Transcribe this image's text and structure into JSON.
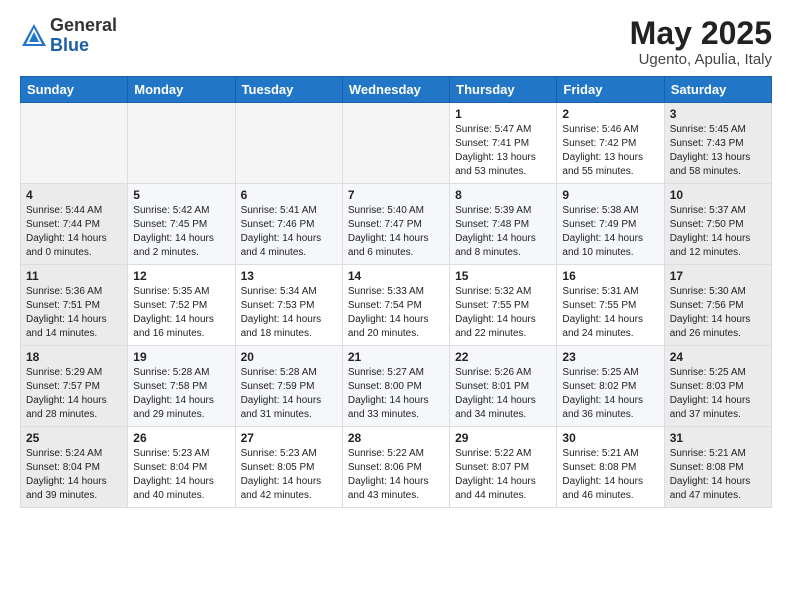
{
  "header": {
    "logo_general": "General",
    "logo_blue": "Blue",
    "month_year": "May 2025",
    "location": "Ugento, Apulia, Italy"
  },
  "days_of_week": [
    "Sunday",
    "Monday",
    "Tuesday",
    "Wednesday",
    "Thursday",
    "Friday",
    "Saturday"
  ],
  "weeks": [
    [
      {
        "day": "",
        "info": ""
      },
      {
        "day": "",
        "info": ""
      },
      {
        "day": "",
        "info": ""
      },
      {
        "day": "",
        "info": ""
      },
      {
        "day": "1",
        "info": "Sunrise: 5:47 AM\nSunset: 7:41 PM\nDaylight: 13 hours\nand 53 minutes."
      },
      {
        "day": "2",
        "info": "Sunrise: 5:46 AM\nSunset: 7:42 PM\nDaylight: 13 hours\nand 55 minutes."
      },
      {
        "day": "3",
        "info": "Sunrise: 5:45 AM\nSunset: 7:43 PM\nDaylight: 13 hours\nand 58 minutes."
      }
    ],
    [
      {
        "day": "4",
        "info": "Sunrise: 5:44 AM\nSunset: 7:44 PM\nDaylight: 14 hours\nand 0 minutes."
      },
      {
        "day": "5",
        "info": "Sunrise: 5:42 AM\nSunset: 7:45 PM\nDaylight: 14 hours\nand 2 minutes."
      },
      {
        "day": "6",
        "info": "Sunrise: 5:41 AM\nSunset: 7:46 PM\nDaylight: 14 hours\nand 4 minutes."
      },
      {
        "day": "7",
        "info": "Sunrise: 5:40 AM\nSunset: 7:47 PM\nDaylight: 14 hours\nand 6 minutes."
      },
      {
        "day": "8",
        "info": "Sunrise: 5:39 AM\nSunset: 7:48 PM\nDaylight: 14 hours\nand 8 minutes."
      },
      {
        "day": "9",
        "info": "Sunrise: 5:38 AM\nSunset: 7:49 PM\nDaylight: 14 hours\nand 10 minutes."
      },
      {
        "day": "10",
        "info": "Sunrise: 5:37 AM\nSunset: 7:50 PM\nDaylight: 14 hours\nand 12 minutes."
      }
    ],
    [
      {
        "day": "11",
        "info": "Sunrise: 5:36 AM\nSunset: 7:51 PM\nDaylight: 14 hours\nand 14 minutes."
      },
      {
        "day": "12",
        "info": "Sunrise: 5:35 AM\nSunset: 7:52 PM\nDaylight: 14 hours\nand 16 minutes."
      },
      {
        "day": "13",
        "info": "Sunrise: 5:34 AM\nSunset: 7:53 PM\nDaylight: 14 hours\nand 18 minutes."
      },
      {
        "day": "14",
        "info": "Sunrise: 5:33 AM\nSunset: 7:54 PM\nDaylight: 14 hours\nand 20 minutes."
      },
      {
        "day": "15",
        "info": "Sunrise: 5:32 AM\nSunset: 7:55 PM\nDaylight: 14 hours\nand 22 minutes."
      },
      {
        "day": "16",
        "info": "Sunrise: 5:31 AM\nSunset: 7:55 PM\nDaylight: 14 hours\nand 24 minutes."
      },
      {
        "day": "17",
        "info": "Sunrise: 5:30 AM\nSunset: 7:56 PM\nDaylight: 14 hours\nand 26 minutes."
      }
    ],
    [
      {
        "day": "18",
        "info": "Sunrise: 5:29 AM\nSunset: 7:57 PM\nDaylight: 14 hours\nand 28 minutes."
      },
      {
        "day": "19",
        "info": "Sunrise: 5:28 AM\nSunset: 7:58 PM\nDaylight: 14 hours\nand 29 minutes."
      },
      {
        "day": "20",
        "info": "Sunrise: 5:28 AM\nSunset: 7:59 PM\nDaylight: 14 hours\nand 31 minutes."
      },
      {
        "day": "21",
        "info": "Sunrise: 5:27 AM\nSunset: 8:00 PM\nDaylight: 14 hours\nand 33 minutes."
      },
      {
        "day": "22",
        "info": "Sunrise: 5:26 AM\nSunset: 8:01 PM\nDaylight: 14 hours\nand 34 minutes."
      },
      {
        "day": "23",
        "info": "Sunrise: 5:25 AM\nSunset: 8:02 PM\nDaylight: 14 hours\nand 36 minutes."
      },
      {
        "day": "24",
        "info": "Sunrise: 5:25 AM\nSunset: 8:03 PM\nDaylight: 14 hours\nand 37 minutes."
      }
    ],
    [
      {
        "day": "25",
        "info": "Sunrise: 5:24 AM\nSunset: 8:04 PM\nDaylight: 14 hours\nand 39 minutes."
      },
      {
        "day": "26",
        "info": "Sunrise: 5:23 AM\nSunset: 8:04 PM\nDaylight: 14 hours\nand 40 minutes."
      },
      {
        "day": "27",
        "info": "Sunrise: 5:23 AM\nSunset: 8:05 PM\nDaylight: 14 hours\nand 42 minutes."
      },
      {
        "day": "28",
        "info": "Sunrise: 5:22 AM\nSunset: 8:06 PM\nDaylight: 14 hours\nand 43 minutes."
      },
      {
        "day": "29",
        "info": "Sunrise: 5:22 AM\nSunset: 8:07 PM\nDaylight: 14 hours\nand 44 minutes."
      },
      {
        "day": "30",
        "info": "Sunrise: 5:21 AM\nSunset: 8:08 PM\nDaylight: 14 hours\nand 46 minutes."
      },
      {
        "day": "31",
        "info": "Sunrise: 5:21 AM\nSunset: 8:08 PM\nDaylight: 14 hours\nand 47 minutes."
      }
    ]
  ]
}
